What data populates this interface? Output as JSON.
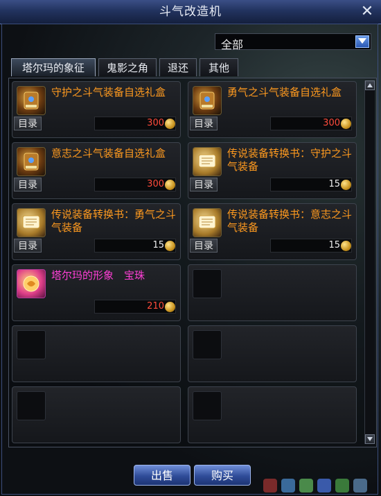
{
  "window": {
    "title": "斗气改造机"
  },
  "filter": {
    "selected": "全部"
  },
  "tabs": [
    {
      "label": "塔尔玛的象征",
      "active": true
    },
    {
      "label": "鬼影之角",
      "active": false
    },
    {
      "label": "退还",
      "active": false
    },
    {
      "label": "其他",
      "active": false
    }
  ],
  "items": [
    {
      "name": "守护之斗气装备自选礼盒",
      "price": "300",
      "catalog": "目录",
      "name_color": "orange",
      "price_color": "red",
      "icon": "armor-chest-icon"
    },
    {
      "name": "勇气之斗气装备自选礼盒",
      "price": "300",
      "catalog": "目录",
      "name_color": "orange",
      "price_color": "red",
      "icon": "armor-chest-icon"
    },
    {
      "name": "意志之斗气装备自选礼盒",
      "price": "300",
      "catalog": "目录",
      "name_color": "orange",
      "price_color": "red",
      "icon": "armor-chest-icon"
    },
    {
      "name": "传说装备转换书：守护之斗气装备",
      "price": "15",
      "catalog": "目录",
      "name_color": "orange",
      "price_color": "white",
      "icon": "scroll-book-icon"
    },
    {
      "name": "传说装备转换书：勇气之斗气装备",
      "price": "15",
      "catalog": "目录",
      "name_color": "orange",
      "price_color": "white",
      "icon": "scroll-book-icon"
    },
    {
      "name": "传说装备转换书：意志之斗气装备",
      "price": "15",
      "catalog": "目录",
      "name_color": "orange",
      "price_color": "white",
      "icon": "scroll-book-icon"
    },
    {
      "name": "塔尔玛的形象　宝珠",
      "price": "210",
      "catalog": "",
      "name_color": "pink",
      "price_color": "red",
      "icon": "orb-gem-icon"
    }
  ],
  "buttons": {
    "sell": "出售",
    "buy": "购买"
  },
  "colors": {
    "orange_text": "#ff9a1f",
    "pink_text": "#ff3fd6",
    "red_price": "#ff4b3b",
    "title_bar": "#22335f"
  }
}
